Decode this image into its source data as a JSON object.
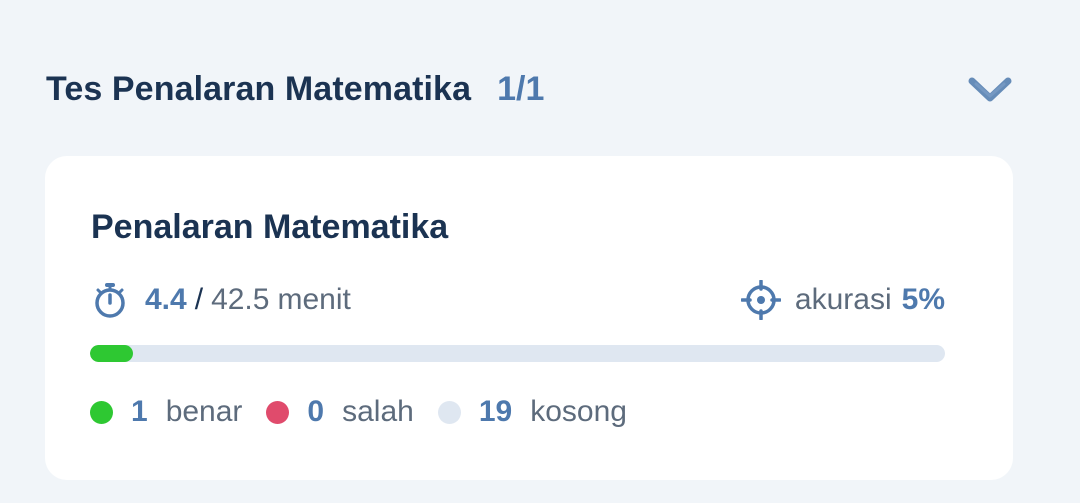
{
  "section": {
    "title": "Tes Penalaran Matematika",
    "count_current": "1",
    "count_separator": "/",
    "count_total": "1",
    "chevron_icon": "chevron-down-icon"
  },
  "card": {
    "title": "Penalaran Matematika",
    "time": {
      "icon": "stopwatch-icon",
      "spent": "4.4",
      "separator": "/",
      "total": "42.5",
      "unit": "menit"
    },
    "accuracy": {
      "icon": "crosshair-icon",
      "label": "akurasi",
      "value": "5%"
    },
    "progress": {
      "fraction": 0.05,
      "fill_color": "#2ec832",
      "track_color": "#dfe7f1"
    },
    "legend": [
      {
        "count": "1",
        "label": "benar",
        "color": "#2ec832"
      },
      {
        "count": "0",
        "label": "salah",
        "color": "#e04b6c"
      },
      {
        "count": "19",
        "label": "kosong",
        "color": "#dfe7f1"
      }
    ]
  },
  "colors": {
    "accent": "#4e79ad",
    "heading": "#1b3352",
    "muted": "#5d6b7c",
    "background": "#f1f5f9"
  }
}
